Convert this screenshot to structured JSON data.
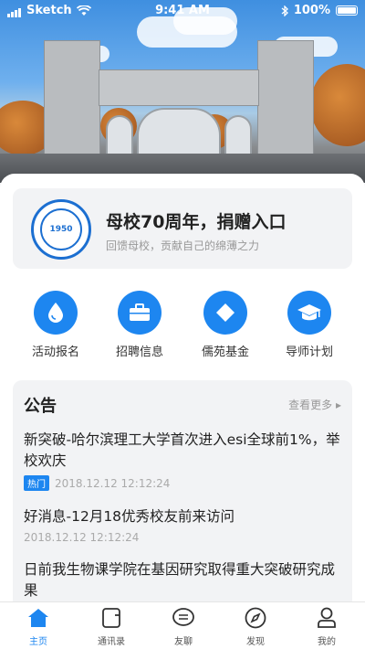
{
  "status_bar": {
    "carrier": "Sketch",
    "time": "9:41 AM",
    "battery": "100%"
  },
  "donate_card": {
    "title": "母校70周年，捐赠入口",
    "subtitle": "回馈母校，贡献自己的绵薄之力",
    "logo_number": "1950"
  },
  "quick_actions": [
    {
      "label": "活动报名",
      "icon": "water-drop-icon"
    },
    {
      "label": "招聘信息",
      "icon": "briefcase-icon"
    },
    {
      "label": "儒苑基金",
      "icon": "diamond-icon"
    },
    {
      "label": "导师计划",
      "icon": "graduation-cap-icon"
    }
  ],
  "notice": {
    "title": "公告",
    "more": "查看更多",
    "items": [
      {
        "title": "新突破-哈尔滨理工大学首次进入esi全球前1%，举校欢庆",
        "tag": "热门",
        "time": "2018.12.12  12:12:24"
      },
      {
        "title": "好消息-12月18优秀校友前来访问",
        "time": "2018.12.12  12:12:24"
      },
      {
        "title": "日前我生物课学院在基因研究取得重大突破研究成果"
      }
    ]
  },
  "tabbar": [
    {
      "label": "主页",
      "icon": "home-icon",
      "active": true
    },
    {
      "label": "通讯录",
      "icon": "contacts-icon"
    },
    {
      "label": "友聊",
      "icon": "chat-icon"
    },
    {
      "label": "发现",
      "icon": "compass-icon"
    },
    {
      "label": "我的",
      "icon": "user-icon"
    }
  ],
  "colors": {
    "primary": "#1d86f0",
    "card_bg": "#f2f3f5"
  }
}
